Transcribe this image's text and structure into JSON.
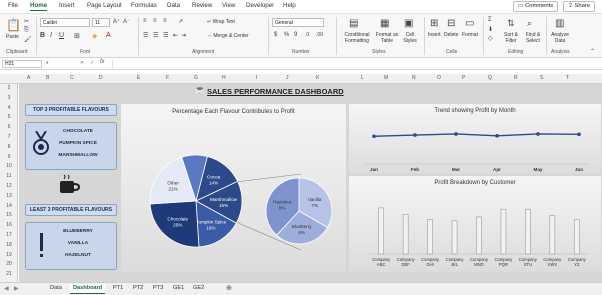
{
  "menu": {
    "tabs": [
      "File",
      "Home",
      "Insert",
      "Page Layout",
      "Formulas",
      "Data",
      "Review",
      "View",
      "Developer",
      "Help"
    ],
    "active": "Home",
    "comments_label": "Comments",
    "share_label": "Share"
  },
  "ribbon": {
    "paste_label": "Paste",
    "font_name": "Calibri",
    "font_size": "11",
    "wrap_text_label": "Wrap Text",
    "merge_center_label": "Merge & Center",
    "number_format": "General",
    "cond_format_label": "Conditional Formatting",
    "format_table_label": "Format as Table",
    "cell_styles_label": "Cell Styles",
    "insert_label": "Insert",
    "delete_label": "Delete",
    "format_label": "Format",
    "sort_filter_label": "Sort & Filter",
    "find_select_label": "Find & Select",
    "analyze_label": "Analyze Data",
    "groups": [
      "Clipboard",
      "Font",
      "Alignment",
      "Number",
      "Styles",
      "Cells",
      "Editing",
      "Analysis"
    ]
  },
  "formula_bar": {
    "name_box": "H31",
    "fx": "fx",
    "value": ""
  },
  "columns": [
    "A",
    "B",
    "C",
    "D",
    "E",
    "F",
    "G",
    "H",
    "I",
    "J",
    "K",
    "L",
    "M",
    "N",
    "O",
    "P",
    "Q",
    "R",
    "S",
    "T"
  ],
  "rows": [
    "2",
    "3",
    "4",
    "5",
    "6",
    "7",
    "8",
    "9",
    "10",
    "11",
    "12",
    "13",
    "14",
    "15",
    "16",
    "17",
    "18",
    "19",
    "20",
    "21"
  ],
  "dashboard": {
    "title": "SALES PERFORMANCE DASHBOARD",
    "top3_title": "TOP 3 PROFITABLE FLAVOURS",
    "top3": [
      "CHOCOLATE",
      "PUMPKIN SPICE",
      "MARSHMALLOW"
    ],
    "least3_title": "LEAST 3 PROFITABLE FLAVOURS",
    "least3": [
      "BLUEBERRY",
      "VANILLA",
      "HAZELNUT"
    ],
    "pie_title": "Percentage Each Flavour Contributes to Profit",
    "trend_title": "Trend showing Profit by Month",
    "bar_title": "Profit Breakdown by Customer",
    "colors": {
      "navy": "#2c4a8a",
      "mid": "#5a79c2",
      "light": "#9fb1de",
      "pale": "#d5ddf2"
    }
  },
  "chart_data": [
    {
      "type": "pie",
      "title": "Percentage Each Flavour Contributes to Profit",
      "slices": [
        {
          "label": "Cocoa",
          "pct": 14,
          "name": "Coconut"
        },
        {
          "label": "Marshmallow",
          "pct": 15
        },
        {
          "label": "Pumpkin Spice",
          "pct": 16
        },
        {
          "label": "Chocolate",
          "pct": 25
        },
        {
          "label": "Other",
          "pct": 21
        },
        {
          "label": "",
          "pct": 9
        }
      ],
      "secondary": [
        {
          "label": "Vanilla",
          "pct": 7
        },
        {
          "label": "Blueberry",
          "pct": 6
        },
        {
          "label": "Hazelnut",
          "pct": 8
        }
      ]
    },
    {
      "type": "line",
      "title": "Trend showing Profit by Month",
      "categories": [
        "Jan",
        "Feb",
        "Mar",
        "Apr",
        "May",
        "Jun"
      ],
      "values": [
        52,
        55,
        58,
        53,
        58,
        57
      ],
      "ylim": [
        0,
        100
      ]
    },
    {
      "type": "bar",
      "title": "Profit Breakdown by Customer",
      "categories": [
        "Company ABC",
        "Company DEF",
        "Company GHI",
        "Company JKL",
        "Company MNO",
        "Company PQR",
        "Company STU",
        "Company VWX",
        "Company YZ"
      ],
      "values": [
        72,
        62,
        54,
        52,
        58,
        70,
        70,
        60,
        54
      ],
      "ylim": [
        0,
        100
      ]
    }
  ],
  "sheet_tabs": [
    "Data",
    "Dashboard",
    "PT1",
    "PT2",
    "PT3",
    "GE1",
    "GE2"
  ],
  "active_sheet": "Dashboard"
}
